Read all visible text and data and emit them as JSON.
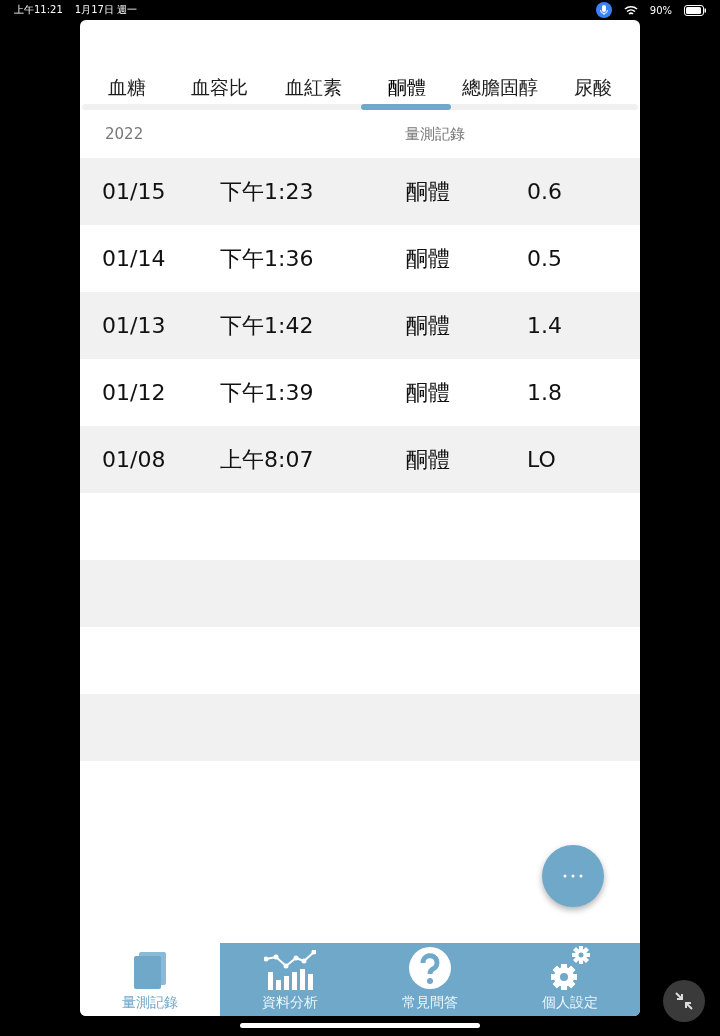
{
  "status_bar": {
    "time": "上午11:21",
    "date": "1月17日 週一",
    "battery": "90%"
  },
  "tabs": [
    {
      "label": "血糖",
      "selected": false
    },
    {
      "label": "血容比",
      "selected": false
    },
    {
      "label": "血紅素",
      "selected": false
    },
    {
      "label": "酮體",
      "selected": true
    },
    {
      "label": "總膽固醇",
      "selected": false
    },
    {
      "label": "尿酸",
      "selected": false
    }
  ],
  "table": {
    "year": "2022",
    "title": "量測記錄",
    "rows": [
      {
        "date": "01/15",
        "time": "下午1:23",
        "type": "酮體",
        "value": "0.6"
      },
      {
        "date": "01/14",
        "time": "下午1:36",
        "type": "酮體",
        "value": "0.5"
      },
      {
        "date": "01/13",
        "time": "下午1:42",
        "type": "酮體",
        "value": "1.4"
      },
      {
        "date": "01/12",
        "time": "下午1:39",
        "type": "酮體",
        "value": "1.8"
      },
      {
        "date": "01/08",
        "time": "上午8:07",
        "type": "酮體",
        "value": "LO"
      }
    ]
  },
  "bottom_nav": [
    {
      "label": "量測記錄",
      "kind": "records",
      "selected": true
    },
    {
      "label": "資料分析",
      "kind": "analysis",
      "selected": false
    },
    {
      "label": "常見問答",
      "kind": "faq",
      "selected": false
    },
    {
      "label": "個人設定",
      "kind": "settings",
      "selected": false
    }
  ]
}
